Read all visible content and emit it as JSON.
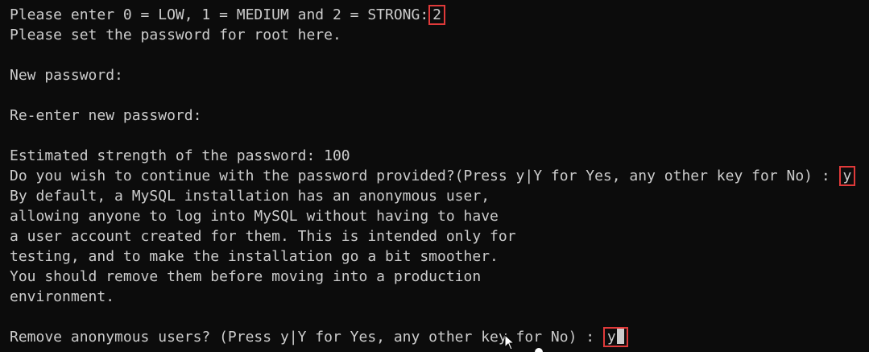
{
  "terminal": {
    "lines": [
      {
        "text": "Please enter 0 = LOW, 1 = MEDIUM and 2 = STRONG:",
        "input": "2"
      },
      {
        "text": "Please set the password for root here."
      },
      {
        "text": ""
      },
      {
        "text": "New password:"
      },
      {
        "text": ""
      },
      {
        "text": "Re-enter new password:"
      },
      {
        "text": ""
      },
      {
        "text": "Estimated strength of the password: 100"
      },
      {
        "text": "Do you wish to continue with the password provided?(Press y|Y for Yes, any other key for No) :",
        "input": "y"
      },
      {
        "text": "By default, a MySQL installation has an anonymous user,"
      },
      {
        "text": "allowing anyone to log into MySQL without having to have"
      },
      {
        "text": "a user account created for them. This is intended only for"
      },
      {
        "text": "testing, and to make the installation go a bit smoother."
      },
      {
        "text": "You should remove them before moving into a production"
      },
      {
        "text": "environment."
      },
      {
        "text": ""
      },
      {
        "text": "Remove anonymous users? (Press y|Y for Yes, any other key for No) :",
        "input": "y"
      }
    ]
  },
  "colors": {
    "background": "#0c0c0c",
    "foreground": "#cccccc",
    "highlight_border": "#e03a3a"
  },
  "icons": {
    "cursor": "block-cursor-icon",
    "mouse": "mouse-pointer-icon"
  }
}
